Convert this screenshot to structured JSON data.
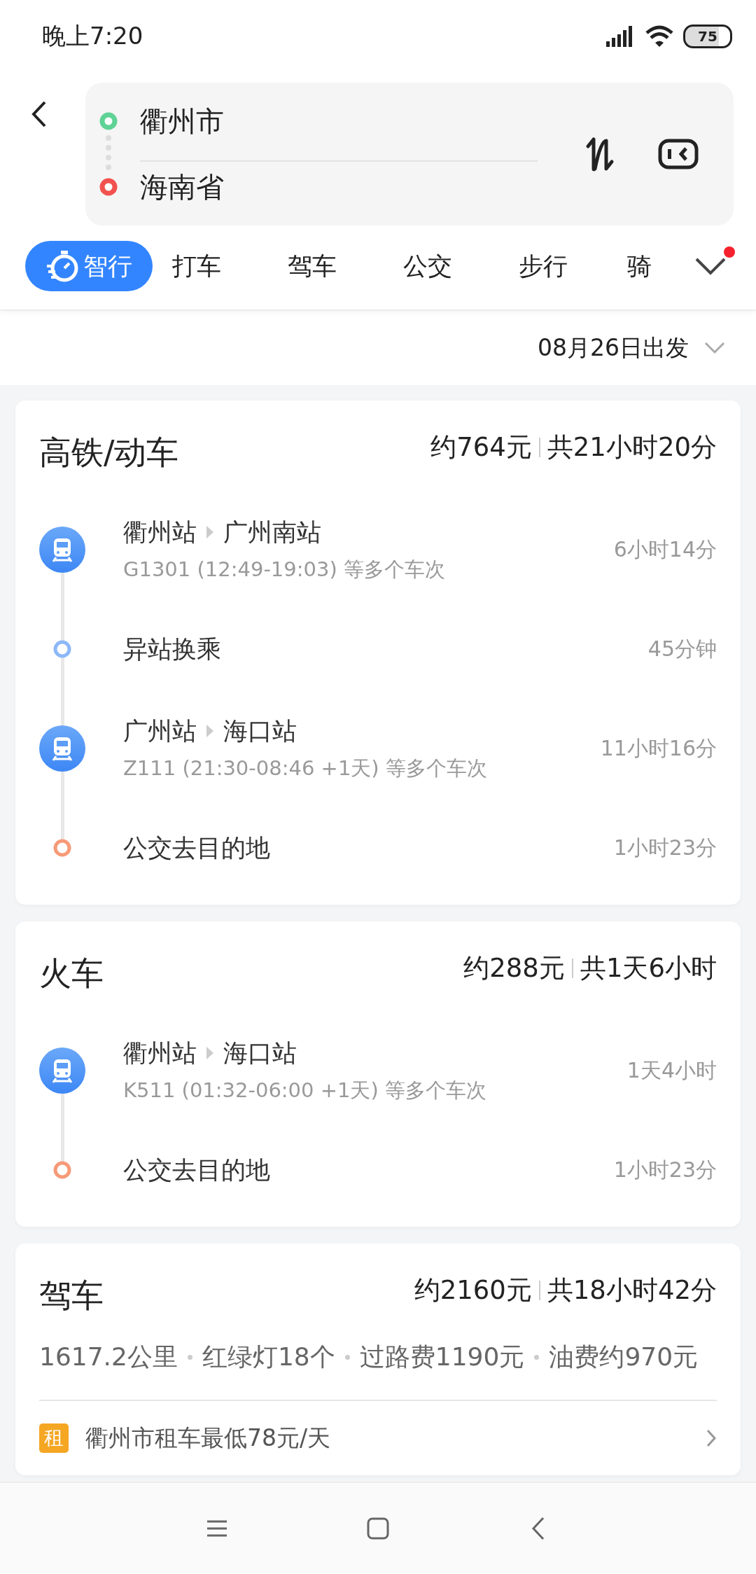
{
  "status_bar": {
    "time": "晚上7:20",
    "battery": "75"
  },
  "route": {
    "origin": "衢州市",
    "destination": "海南省"
  },
  "tabs": [
    {
      "label": "智行",
      "selected": true
    },
    {
      "label": "打车",
      "selected": false
    },
    {
      "label": "驾车",
      "selected": false
    },
    {
      "label": "公交",
      "selected": false
    },
    {
      "label": "步行",
      "selected": false
    },
    {
      "label": "骑",
      "selected": false
    }
  ],
  "more_tabs": {
    "badge": true
  },
  "departure": {
    "label": "08月26日出发"
  },
  "plans": [
    {
      "kind": "rail",
      "title": "高铁/动车",
      "price": "约764元",
      "duration": "共21小时20分",
      "legs": [
        {
          "kind": "train",
          "from": "衢州站",
          "to": "广州南站",
          "detail": "G1301 (12:49-19:03) 等多个车次",
          "time": "6小时14分"
        },
        {
          "kind": "transfer",
          "label": "异站换乘",
          "time": "45分钟"
        },
        {
          "kind": "train",
          "from": "广州站",
          "to": "海口站",
          "detail": "Z111 (21:30-08:46 +1天) 等多个车次",
          "time": "11小时16分"
        },
        {
          "kind": "bus",
          "label": "公交去目的地",
          "time": "1小时23分"
        }
      ]
    },
    {
      "kind": "rail",
      "title": "火车",
      "price": "约288元",
      "duration": "共1天6小时",
      "legs": [
        {
          "kind": "train",
          "from": "衢州站",
          "to": "海口站",
          "detail": "K511 (01:32-06:00 +1天) 等多个车次",
          "time": "1天4小时"
        },
        {
          "kind": "bus",
          "label": "公交去目的地",
          "time": "1小时23分"
        }
      ]
    },
    {
      "kind": "drive",
      "title": "驾车",
      "price": "约2160元",
      "duration": "共18小时42分",
      "stats": [
        "1617.2公里",
        "红绿灯18个",
        "过路费1190元",
        "油费约970元"
      ],
      "rental": {
        "badge": "租",
        "text": "衢州市租车最低78元/天"
      }
    }
  ]
}
